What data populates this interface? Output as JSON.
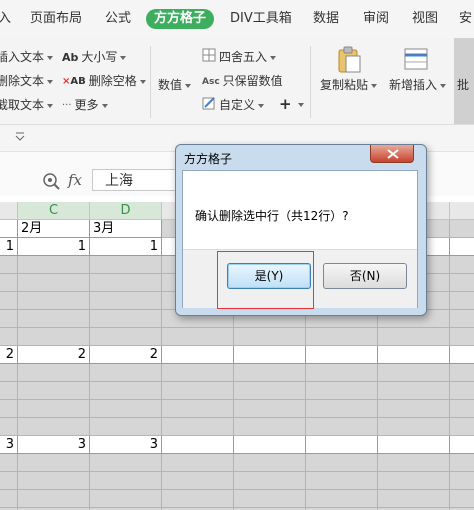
{
  "menu": {
    "items": [
      "入",
      "页面布局",
      "公式",
      "方方格子",
      "DIV工具箱",
      "数据",
      "审阅",
      "视图",
      "安"
    ],
    "active_index": 3
  },
  "ribbon": {
    "group1": [
      "插入文本",
      "删除文本",
      "截取文本"
    ],
    "group2": [
      "大小写",
      "删除空格",
      "更多"
    ],
    "group3": {
      "numeric": "数值",
      "round": "四舍五入",
      "keep_numeric": "只保留数值",
      "custom": "自定义",
      "plus": "+"
    },
    "group4": {
      "copy_paste": "复制粘贴",
      "new_insert": "新增插入",
      "batch": "批"
    }
  },
  "formula_bar": {
    "fx": "fx",
    "value": "上海"
  },
  "sheet": {
    "col_headers": [
      "C",
      "D"
    ],
    "rows": [
      {
        "c": "2月",
        "d": "3月",
        "b": "",
        "type": "header"
      },
      {
        "c": "1",
        "d": "1",
        "b": "1",
        "type": "value"
      },
      {
        "c": "",
        "d": "",
        "b": "",
        "type": "empty"
      },
      {
        "c": "",
        "d": "",
        "b": "",
        "type": "empty"
      },
      {
        "c": "",
        "d": "",
        "b": "",
        "type": "empty"
      },
      {
        "c": "",
        "d": "",
        "b": "",
        "type": "empty"
      },
      {
        "c": "",
        "d": "",
        "b": "",
        "type": "empty"
      },
      {
        "c": "2",
        "d": "2",
        "b": "2",
        "type": "value"
      },
      {
        "c": "",
        "d": "",
        "b": "",
        "type": "empty"
      },
      {
        "c": "",
        "d": "",
        "b": "",
        "type": "empty"
      },
      {
        "c": "",
        "d": "",
        "b": "",
        "type": "empty"
      },
      {
        "c": "",
        "d": "",
        "b": "",
        "type": "empty"
      },
      {
        "c": "3",
        "d": "3",
        "b": "3",
        "type": "value"
      },
      {
        "c": "",
        "d": "",
        "b": "",
        "type": "empty"
      },
      {
        "c": "",
        "d": "",
        "b": "",
        "type": "empty"
      },
      {
        "c": "",
        "d": "",
        "b": "",
        "type": "empty"
      },
      {
        "c": "",
        "d": "",
        "b": "",
        "type": "empty"
      }
    ]
  },
  "dialog": {
    "title": "方方格子",
    "message": "确认删除选中行（共12行）?",
    "yes_label": "是(Y)",
    "no_label": "否(N)"
  },
  "colors": {
    "active_tab": "#3cae5e",
    "header_text": "#3a8f4a",
    "highlight": "#e33333"
  }
}
